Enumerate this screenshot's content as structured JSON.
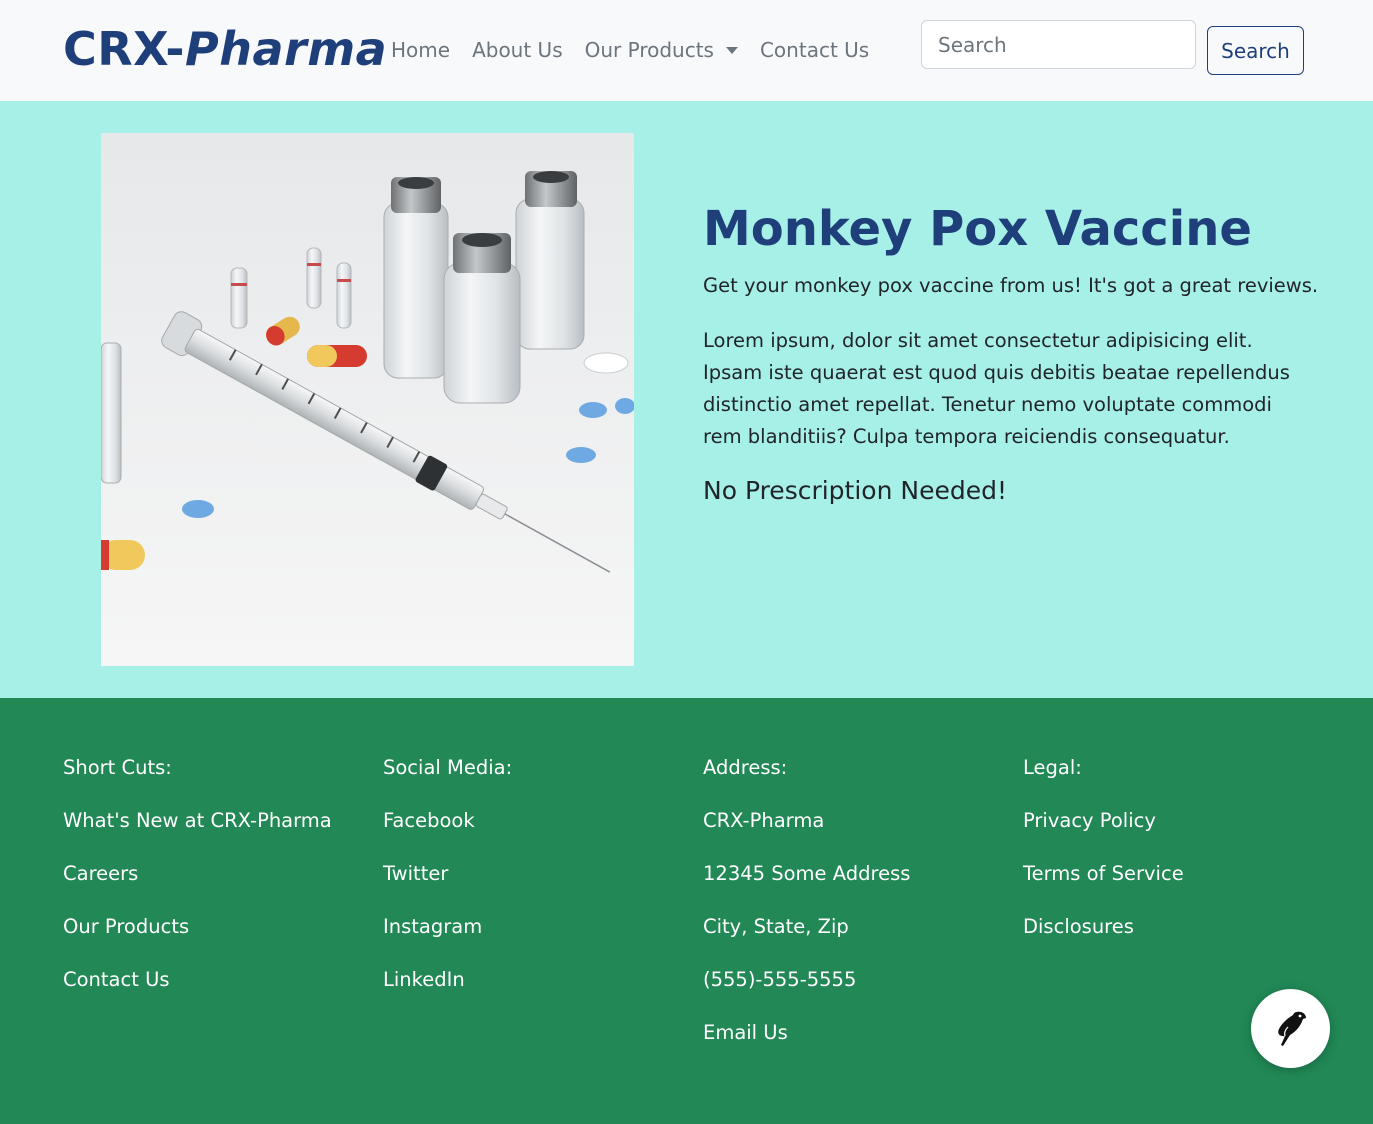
{
  "header": {
    "brand_part1": "CRX-",
    "brand_part2": "Pharma",
    "nav": {
      "home": "Home",
      "about": "About Us",
      "products": "Our Products",
      "contact": "Contact Us"
    },
    "search": {
      "placeholder": "Search",
      "value": "",
      "button_label": "Search"
    }
  },
  "hero": {
    "image_alt": "Syringe, vaccine vials and pills",
    "title": "Monkey Pox Vaccine",
    "subtitle": "Get your monkey pox vaccine from us! It's got a great reviews.",
    "body": "Lorem ipsum, dolor sit amet consectetur adipisicing elit. Ipsam iste quaerat est quod quis debitis beatae repellendus distinctio amet repellat. Tenetur nemo voluptate commodi rem blanditiis? Culpa tempora reiciendis consequatur.",
    "note": "No Prescription Needed!"
  },
  "footer": {
    "shortcuts": {
      "heading": "Short Cuts:",
      "links": [
        "What's New at CRX-Pharma",
        "Careers",
        "Our Products",
        "Contact Us"
      ]
    },
    "social": {
      "heading": "Social Media:",
      "links": [
        "Facebook",
        "Twitter",
        "Instagram",
        "LinkedIn"
      ]
    },
    "address": {
      "heading": "Address:",
      "lines": [
        "CRX-Pharma",
        "12345 Some Address",
        "City, State, Zip",
        "(555)-555-5555",
        "Email Us"
      ]
    },
    "legal": {
      "heading": "Legal:",
      "links": [
        "Privacy Policy",
        "Terms of Service",
        "Disclosures"
      ]
    }
  },
  "fab": {
    "icon": "bird-icon"
  },
  "colors": {
    "brand": "#1f3f7a",
    "hero_bg": "#a6f0e8",
    "footer_bg": "#218856",
    "navbar_bg": "#f8f9fa"
  }
}
